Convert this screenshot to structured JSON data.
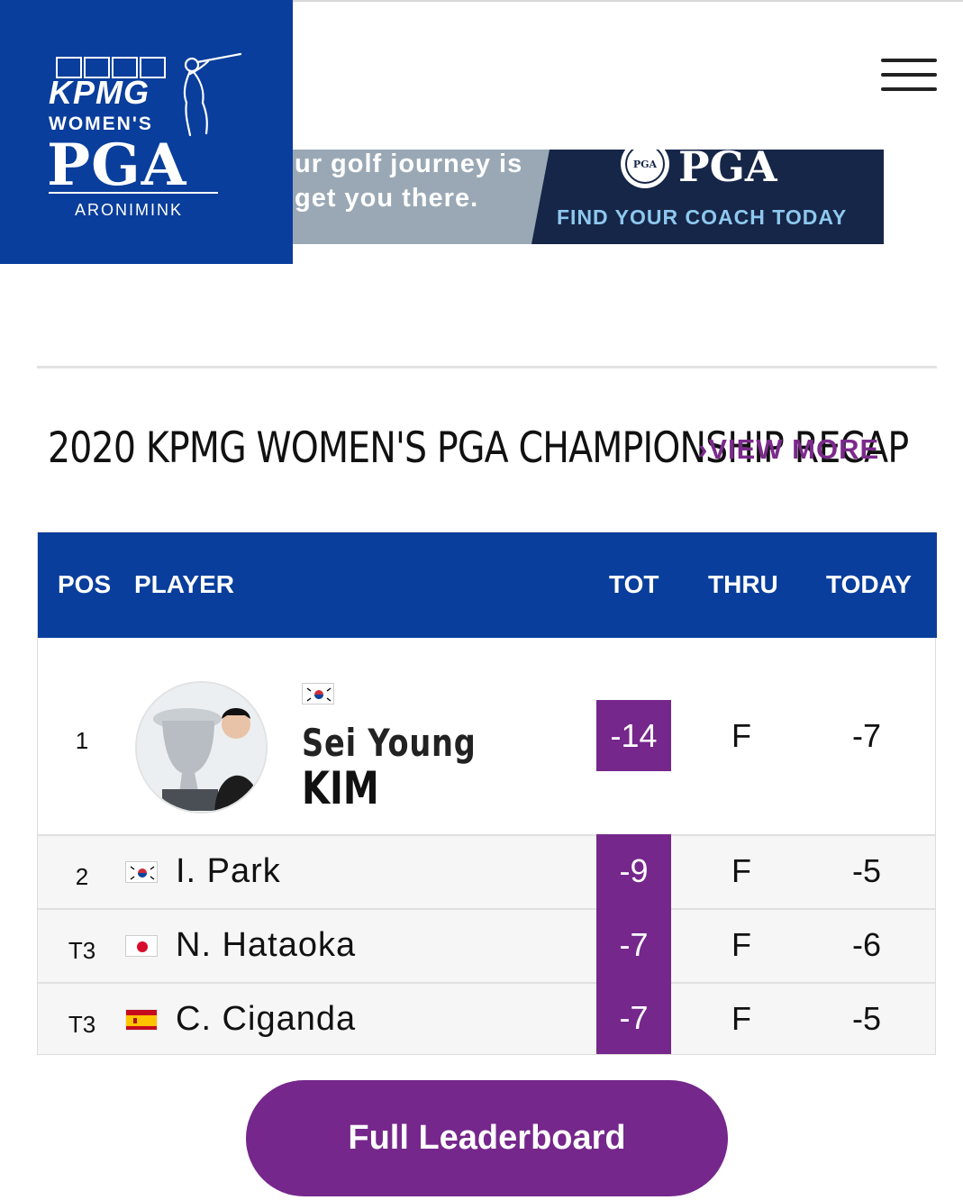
{
  "header": {
    "logo": {
      "brand": "KPMG",
      "line1": "WOMEN'S",
      "line2": "PGA",
      "venue": "ARONIMINK"
    },
    "menu_icon": "hamburger-menu-icon"
  },
  "ad": {
    "line1": "ur golf journey is",
    "line2": "get you there.",
    "brand": "PGA",
    "cta": "FIND YOUR COACH TODAY",
    "colors": {
      "left_bg": "#9aa8b5",
      "right_bg": "#162648",
      "cta": "#8ec8ee"
    }
  },
  "section": {
    "title": "2020 KPMG WOMEN'S PGA CHAMPIONSHIP RECAP",
    "view_more": "VIEW MORE"
  },
  "leaderboard": {
    "columns": {
      "pos": "POS",
      "player": "PLAYER",
      "tot": "TOT",
      "thru": "THRU",
      "today": "TODAY"
    },
    "leader": {
      "pos": "1",
      "first_name": "Sei Young",
      "last_name": "KIM",
      "country_flag": "south-korea-flag",
      "tot": "-14",
      "thru": "F",
      "today": "-7"
    },
    "rows": [
      {
        "pos": "2",
        "name": "I. Park",
        "country_flag": "south-korea-flag",
        "tot": "-9",
        "thru": "F",
        "today": "-5"
      },
      {
        "pos": "T3",
        "name": "N. Hataoka",
        "country_flag": "japan-flag",
        "tot": "-7",
        "thru": "F",
        "today": "-6"
      },
      {
        "pos": "T3",
        "name": "C. Ciganda",
        "country_flag": "spain-flag",
        "tot": "-7",
        "thru": "F",
        "today": "-5"
      }
    ]
  },
  "cta_button": {
    "label": "Full Leaderboard"
  },
  "colors": {
    "brand_blue": "#0a3e9c",
    "accent_purple": "#75278b"
  }
}
